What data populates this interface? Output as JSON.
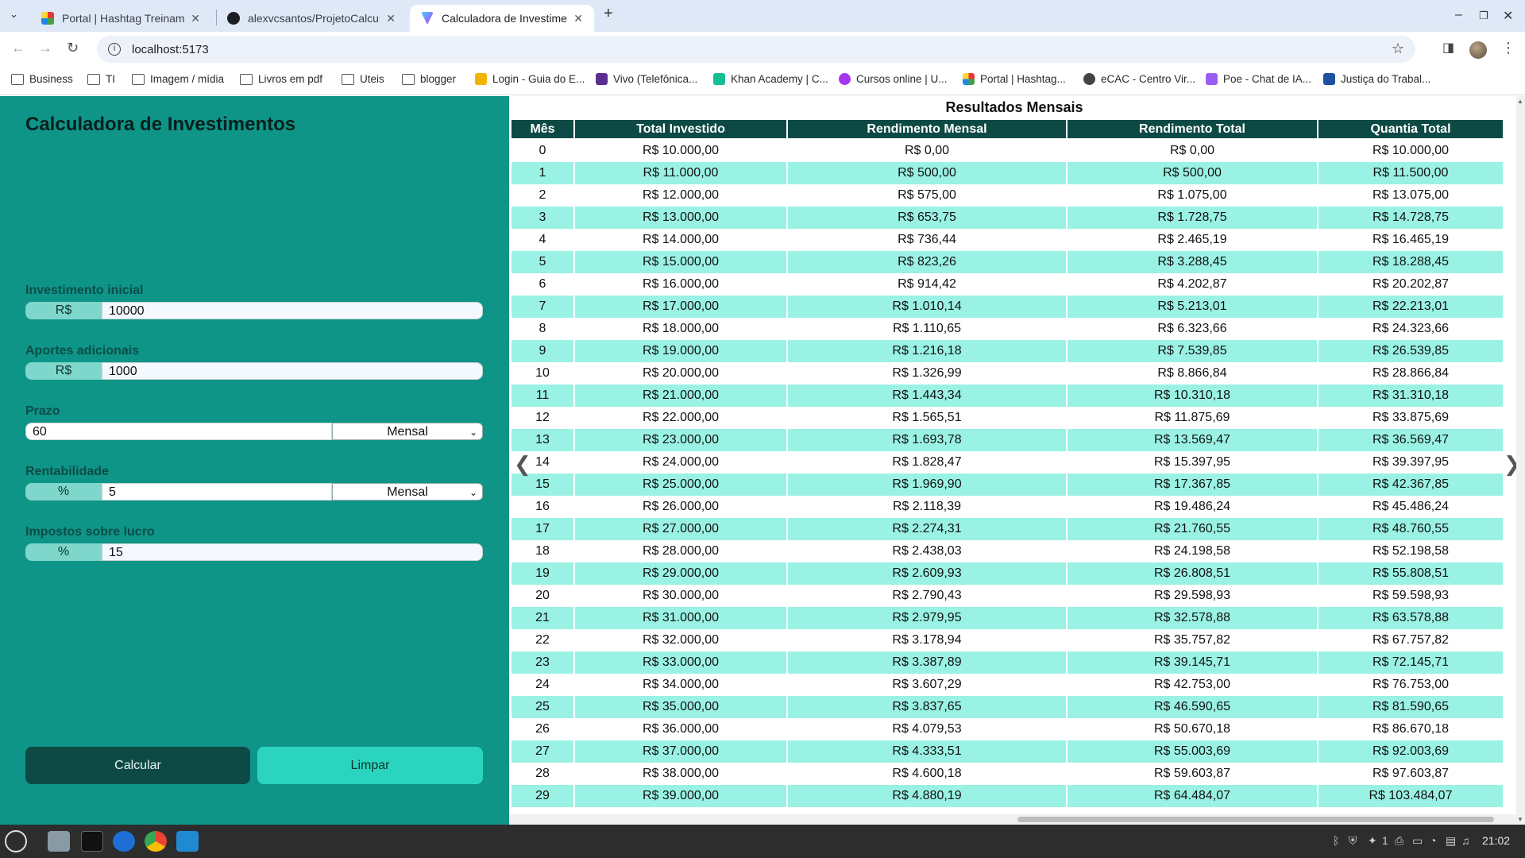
{
  "browser": {
    "tabs": [
      {
        "label": "Portal | Hashtag Treinament"
      },
      {
        "label": "alexvcsantos/ProjetoCalcula"
      },
      {
        "label": "Calculadora de Investimento"
      }
    ],
    "url": "localhost:5173",
    "bookmarks": [
      {
        "label": "Business"
      },
      {
        "label": "TI"
      },
      {
        "label": "Imagem / mídia"
      },
      {
        "label": "Livros em pdf"
      },
      {
        "label": "Uteis"
      },
      {
        "label": "blogger"
      },
      {
        "label": "Login - Guia do E..."
      },
      {
        "label": "Vivo (Telefônica..."
      },
      {
        "label": "Khan Academy | C..."
      },
      {
        "label": "Cursos online | U..."
      },
      {
        "label": "Portal | Hashtag..."
      },
      {
        "label": "eCAC - Centro Vir..."
      },
      {
        "label": "Poe - Chat de IA..."
      },
      {
        "label": "Justiça do Trabal..."
      }
    ]
  },
  "app": {
    "title": "Calculadora de Investimentos",
    "fields": {
      "investimento_inicial": {
        "label": "Investimento inicial",
        "prefix": "R$",
        "value": "10000"
      },
      "aportes": {
        "label": "Aportes adicionais",
        "prefix": "R$",
        "value": "1000"
      },
      "prazo": {
        "label": "Prazo",
        "value": "60",
        "period": "Mensal"
      },
      "rentabilidade": {
        "label": "Rentabilidade",
        "prefix": "%",
        "value": "5",
        "period": "Mensal"
      },
      "impostos": {
        "label": "Impostos sobre lucro",
        "prefix": "%",
        "value": "15"
      }
    },
    "buttons": {
      "calcular": "Calcular",
      "limpar": "Limpar"
    },
    "results": {
      "title": "Resultados Mensais",
      "headers": [
        "Mês",
        "Total Investido",
        "Rendimento Mensal",
        "Rendimento Total",
        "Quantia Total"
      ],
      "rows": [
        [
          "0",
          "R$ 10.000,00",
          "R$ 0,00",
          "R$ 0,00",
          "R$ 10.000,00"
        ],
        [
          "1",
          "R$ 11.000,00",
          "R$ 500,00",
          "R$ 500,00",
          "R$ 11.500,00"
        ],
        [
          "2",
          "R$ 12.000,00",
          "R$ 575,00",
          "R$ 1.075,00",
          "R$ 13.075,00"
        ],
        [
          "3",
          "R$ 13.000,00",
          "R$ 653,75",
          "R$ 1.728,75",
          "R$ 14.728,75"
        ],
        [
          "4",
          "R$ 14.000,00",
          "R$ 736,44",
          "R$ 2.465,19",
          "R$ 16.465,19"
        ],
        [
          "5",
          "R$ 15.000,00",
          "R$ 823,26",
          "R$ 3.288,45",
          "R$ 18.288,45"
        ],
        [
          "6",
          "R$ 16.000,00",
          "R$ 914,42",
          "R$ 4.202,87",
          "R$ 20.202,87"
        ],
        [
          "7",
          "R$ 17.000,00",
          "R$ 1.010,14",
          "R$ 5.213,01",
          "R$ 22.213,01"
        ],
        [
          "8",
          "R$ 18.000,00",
          "R$ 1.110,65",
          "R$ 6.323,66",
          "R$ 24.323,66"
        ],
        [
          "9",
          "R$ 19.000,00",
          "R$ 1.216,18",
          "R$ 7.539,85",
          "R$ 26.539,85"
        ],
        [
          "10",
          "R$ 20.000,00",
          "R$ 1.326,99",
          "R$ 8.866,84",
          "R$ 28.866,84"
        ],
        [
          "11",
          "R$ 21.000,00",
          "R$ 1.443,34",
          "R$ 10.310,18",
          "R$ 31.310,18"
        ],
        [
          "12",
          "R$ 22.000,00",
          "R$ 1.565,51",
          "R$ 11.875,69",
          "R$ 33.875,69"
        ],
        [
          "13",
          "R$ 23.000,00",
          "R$ 1.693,78",
          "R$ 13.569,47",
          "R$ 36.569,47"
        ],
        [
          "14",
          "R$ 24.000,00",
          "R$ 1.828,47",
          "R$ 15.397,95",
          "R$ 39.397,95"
        ],
        [
          "15",
          "R$ 25.000,00",
          "R$ 1.969,90",
          "R$ 17.367,85",
          "R$ 42.367,85"
        ],
        [
          "16",
          "R$ 26.000,00",
          "R$ 2.118,39",
          "R$ 19.486,24",
          "R$ 45.486,24"
        ],
        [
          "17",
          "R$ 27.000,00",
          "R$ 2.274,31",
          "R$ 21.760,55",
          "R$ 48.760,55"
        ],
        [
          "18",
          "R$ 28.000,00",
          "R$ 2.438,03",
          "R$ 24.198,58",
          "R$ 52.198,58"
        ],
        [
          "19",
          "R$ 29.000,00",
          "R$ 2.609,93",
          "R$ 26.808,51",
          "R$ 55.808,51"
        ],
        [
          "20",
          "R$ 30.000,00",
          "R$ 2.790,43",
          "R$ 29.598,93",
          "R$ 59.598,93"
        ],
        [
          "21",
          "R$ 31.000,00",
          "R$ 2.979,95",
          "R$ 32.578,88",
          "R$ 63.578,88"
        ],
        [
          "22",
          "R$ 32.000,00",
          "R$ 3.178,94",
          "R$ 35.757,82",
          "R$ 67.757,82"
        ],
        [
          "23",
          "R$ 33.000,00",
          "R$ 3.387,89",
          "R$ 39.145,71",
          "R$ 72.145,71"
        ],
        [
          "24",
          "R$ 34.000,00",
          "R$ 3.607,29",
          "R$ 42.753,00",
          "R$ 76.753,00"
        ],
        [
          "25",
          "R$ 35.000,00",
          "R$ 3.837,65",
          "R$ 46.590,65",
          "R$ 81.590,65"
        ],
        [
          "26",
          "R$ 36.000,00",
          "R$ 4.079,53",
          "R$ 50.670,18",
          "R$ 86.670,18"
        ],
        [
          "27",
          "R$ 37.000,00",
          "R$ 4.333,51",
          "R$ 55.003,69",
          "R$ 92.003,69"
        ],
        [
          "28",
          "R$ 38.000,00",
          "R$ 4.600,18",
          "R$ 59.603,87",
          "R$ 97.603,87"
        ],
        [
          "29",
          "R$ 39.000,00",
          "R$ 4.880,19",
          "R$ 64.484,07",
          "R$ 103.484,07"
        ]
      ]
    }
  },
  "taskbar": {
    "clock": "21:02",
    "tray_number": "1"
  },
  "colors": {
    "sidebar": "#0f9488",
    "header": "#0e4a45",
    "row_alt": "#9af2e4",
    "clear_button": "#2bd4bf"
  },
  "icons": [
    "tab-search-icon",
    "back-icon",
    "forward-icon",
    "reload-icon",
    "site-info-icon",
    "bookmark-star-icon",
    "side-panel-icon",
    "menu-icon",
    "prev-arrow-icon",
    "next-arrow-icon",
    "chevron-down-icon"
  ]
}
